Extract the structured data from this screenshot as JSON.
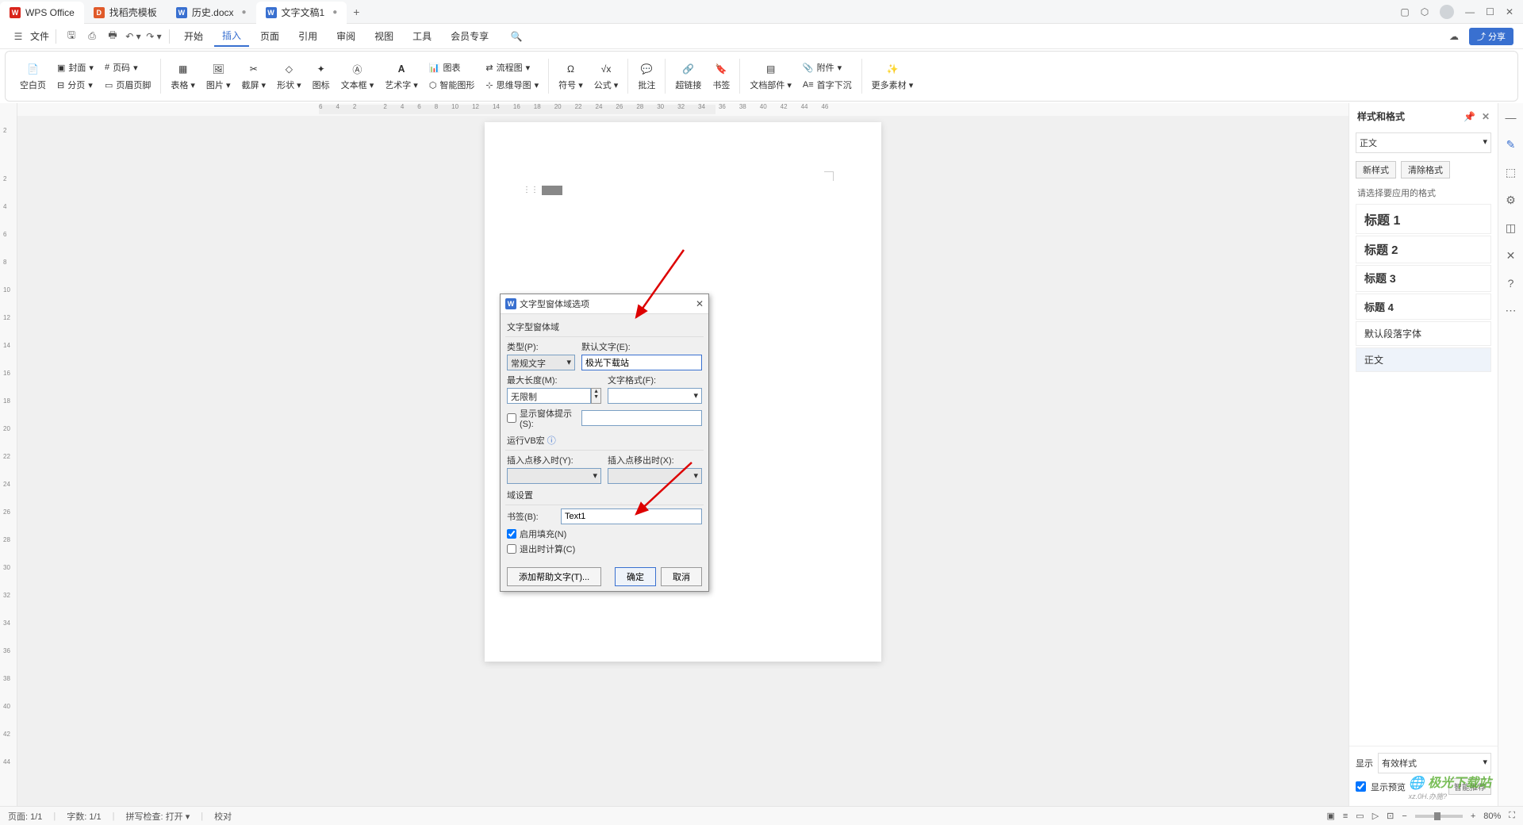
{
  "titlebar": {
    "app": "WPS Office",
    "tabs": [
      {
        "icon": "orange",
        "label": "找稻壳模板"
      },
      {
        "icon": "blue",
        "label": "历史.docx"
      },
      {
        "icon": "blue",
        "label": "文字文稿1"
      }
    ],
    "add": "+"
  },
  "menubar": {
    "file": "文件",
    "tabs": [
      "开始",
      "插入",
      "页面",
      "引用",
      "审阅",
      "视图",
      "工具",
      "会员专享"
    ],
    "active": "插入",
    "share": "分享"
  },
  "ribbon": {
    "blank_page": "空白页",
    "cover": "封面",
    "page_num": "页码",
    "page_break": "分页",
    "header_footer": "页眉页脚",
    "table": "表格",
    "picture": "图片",
    "screenshot": "截屏",
    "shape": "形状",
    "icon": "图标",
    "textbox": "文本框",
    "wordart": "艺术字",
    "chart": "图表",
    "smartart": "智能图形",
    "flowchart": "流程图",
    "mindmap": "思维导图",
    "symbol": "符号",
    "equation": "公式",
    "comment": "批注",
    "hyperlink": "超链接",
    "bookmark": "书签",
    "parts": "文档部件",
    "attachment": "附件",
    "dropcap": "首字下沉",
    "more": "更多素材"
  },
  "ruler_h": [
    "6",
    "4",
    "2",
    "",
    "2",
    "4",
    "6",
    "8",
    "10",
    "12",
    "14",
    "16",
    "18",
    "20",
    "22",
    "24",
    "26",
    "28",
    "30",
    "32",
    "34",
    "36",
    "38",
    "40",
    "42",
    "44",
    "46"
  ],
  "ruler_v": [
    "2",
    "",
    "2",
    "4",
    "6",
    "8",
    "10",
    "12",
    "14",
    "16",
    "18",
    "20",
    "22",
    "24",
    "26",
    "28",
    "30",
    "32",
    "34",
    "36",
    "38",
    "40",
    "42",
    "44"
  ],
  "dialog": {
    "title": "文字型窗体域选项",
    "section1": "文字型窗体域",
    "type_label": "类型(P):",
    "type_value": "常规文字",
    "default_label": "默认文字(E):",
    "default_value": "极光下载站",
    "maxlen_label": "最大长度(M):",
    "maxlen_value": "无限制",
    "format_label": "文字格式(F):",
    "format_value": "",
    "show_prompt": "显示窗体提示(S):",
    "section2": "运行VB宏",
    "enter_label": "插入点移入时(Y):",
    "exit_label": "插入点移出时(X):",
    "section3": "域设置",
    "bookmark_label": "书签(B):",
    "bookmark_value": "Text1",
    "enable_fill": "启用填充(N)",
    "calc_exit": "退出时计算(C)",
    "help_text": "添加帮助文字(T)...",
    "ok": "确定",
    "cancel": "取消"
  },
  "side_panel": {
    "title": "样式和格式",
    "current": "正文",
    "new_style": "新样式",
    "clear_format": "清除格式",
    "select_label": "请选择要应用的格式",
    "styles": [
      {
        "name": "标题 1",
        "cls": "h1"
      },
      {
        "name": "标题 2",
        "cls": "h2"
      },
      {
        "name": "标题 3",
        "cls": "h3"
      },
      {
        "name": "标题 4",
        "cls": "h4"
      },
      {
        "name": "默认段落字体",
        "cls": ""
      },
      {
        "name": "正文",
        "cls": "",
        "selected": true
      }
    ],
    "show_label": "显示",
    "show_value": "有效样式",
    "preview": "显示预览",
    "smart": "智能推荐"
  },
  "statusbar": {
    "page": "页面: 1/1",
    "words": "字数: 1/1",
    "spell": "拼写检查: 打开",
    "proof": "校对",
    "zoom": "80%"
  },
  "watermark": "极光下载站",
  "watermark_sub": "xz.0H.办施?"
}
